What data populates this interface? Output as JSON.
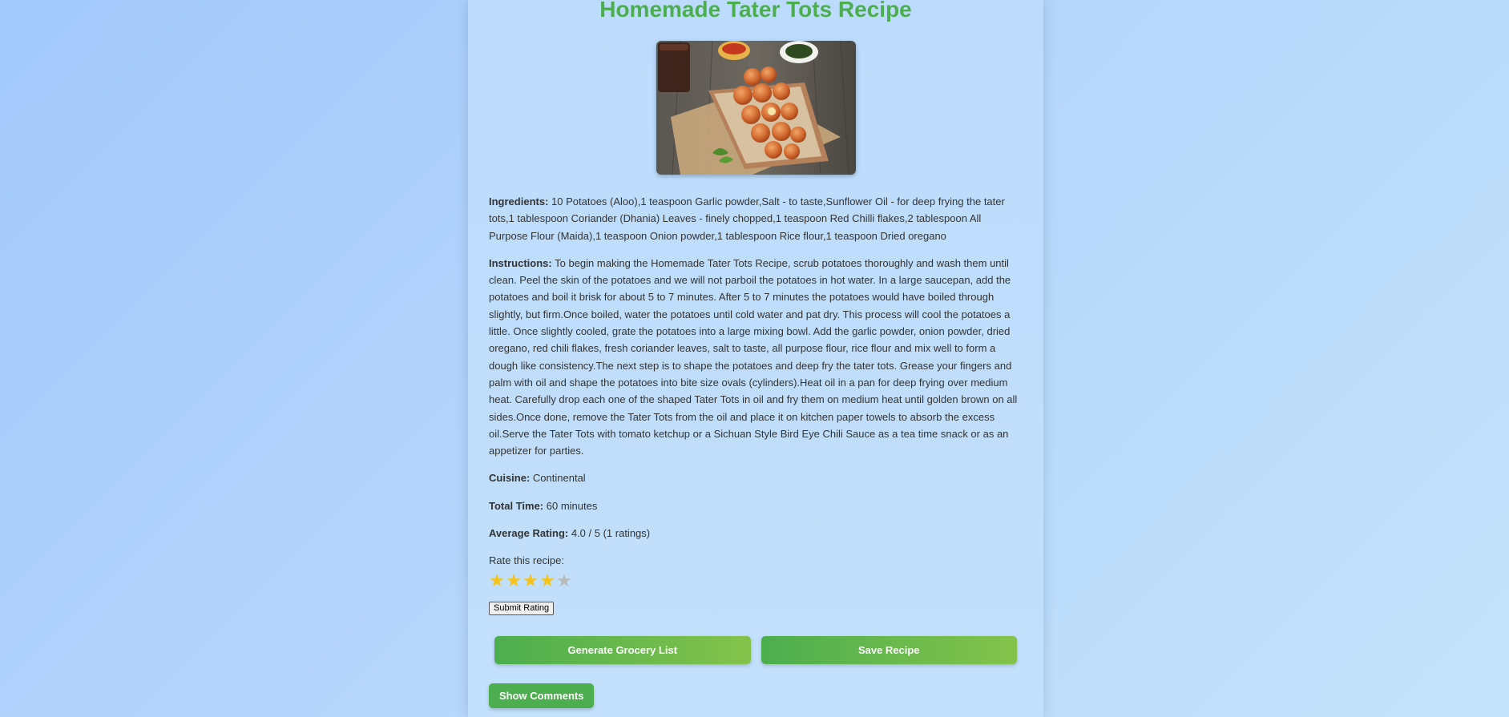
{
  "recipe": {
    "title": "Homemade Tater Tots Recipe",
    "ingredients_label": "Ingredients:",
    "ingredients": "10 Potatoes (Aloo),1 teaspoon Garlic powder,Salt - to taste,Sunflower Oil - for deep frying the tater tots,1 tablespoon Coriander (Dhania) Leaves - finely chopped,1 teaspoon Red Chilli flakes,2 tablespoon All Purpose Flour (Maida),1 teaspoon Onion powder,1 tablespoon Rice flour,1 teaspoon Dried oregano",
    "instructions_label": "Instructions:",
    "instructions": "To begin making the Homemade Tater Tots Recipe, scrub potatoes thoroughly and wash them until clean. Peel the skin of the potatoes and we will not parboil the potatoes in hot water. In a large saucepan, add the potatoes and boil it brisk for about 5 to 7 minutes. After 5 to 7 minutes the potatoes would have boiled through slightly, but firm.Once boiled, water the potatoes until cold water and pat dry. This process will cool the potatoes a little. Once slightly cooled, grate the potatoes into a large mixing bowl. Add the garlic powder, onion powder, dried oregano, red chili flakes, fresh coriander leaves, salt to taste, all purpose flour, rice flour and mix well to form a dough like consistency.The next step is to shape the potatoes and deep fry the tater tots. Grease your fingers and palm with oil and shape the potatoes into bite size ovals (cylinders).Heat oil in a pan for deep frying over medium heat. Carefully drop each one of the shaped Tater Tots in oil and fry them on medium heat until golden brown on all sides.Once done, remove the Tater Tots from the oil and place it on kitchen paper towels to absorb the excess oil.Serve the Tater Tots with tomato ketchup or a Sichuan Style Bird Eye Chili Sauce as a tea time snack or as an appetizer for parties.",
    "cuisine_label": "Cuisine:",
    "cuisine": "Continental",
    "total_time_label": "Total Time:",
    "total_time": "60 minutes",
    "avg_rating_label": "Average Rating:",
    "avg_rating": "4.0 / 5 (1 ratings)"
  },
  "rating": {
    "prompt": "Rate this recipe:",
    "selected": 4,
    "max": 5,
    "submit_label": "Submit Rating"
  },
  "actions": {
    "grocery_label": "Generate Grocery List",
    "save_label": "Save Recipe",
    "comments_label": "Show Comments"
  },
  "colors": {
    "title": "#4cae4f",
    "button_start": "#4cae4f",
    "button_end": "#84c34b",
    "star_on": "#f5c31a",
    "star_off": "#b9b9b9"
  }
}
